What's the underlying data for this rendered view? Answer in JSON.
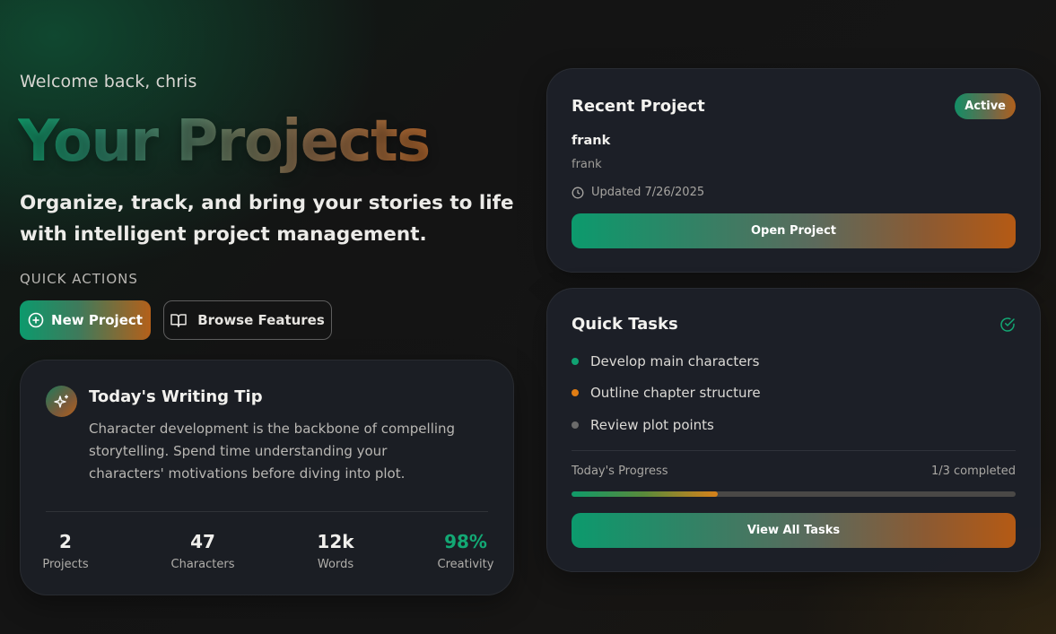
{
  "hero": {
    "welcome": "Welcome back, chris",
    "title": "Your Projects",
    "subtitle": "Organize, track, and bring your stories to life with intelligent project management."
  },
  "quick_actions": {
    "label": "QUICK ACTIONS",
    "new_project": "New Project",
    "browse_features": "Browse Features"
  },
  "tip": {
    "title": "Today's Writing Tip",
    "body": "Character development is the backbone of compelling storytelling. Spend time understanding your characters' motivations before diving into plot."
  },
  "stats": [
    {
      "value": "2",
      "label": "Projects"
    },
    {
      "value": "47",
      "label": "Characters"
    },
    {
      "value": "12k",
      "label": "Words"
    },
    {
      "value": "98%",
      "label": "Creativity"
    }
  ],
  "recent": {
    "title": "Recent Project",
    "badge": "Active",
    "name": "frank",
    "description": "frank",
    "updated": "Updated 7/26/2025",
    "open_button": "Open Project"
  },
  "tasks": {
    "title": "Quick Tasks",
    "items": [
      {
        "label": "Develop main characters",
        "color": "#10a272"
      },
      {
        "label": "Outline chapter structure",
        "color": "#e07d14"
      },
      {
        "label": "Review plot points",
        "color": "#6b6b6b"
      }
    ],
    "progress_label": "Today's Progress",
    "progress_count": "1/3 completed",
    "progress_fraction": 0.33,
    "view_button": "View All Tasks"
  },
  "colors": {
    "accent_green": "#0c9a6d",
    "accent_orange": "#b55a14",
    "creativity_green": "#13a874"
  }
}
